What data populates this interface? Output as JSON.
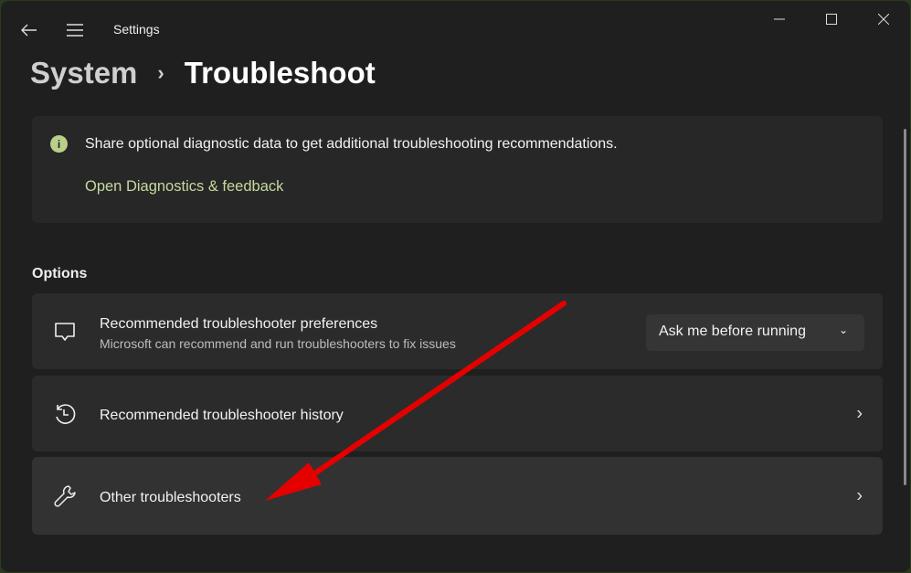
{
  "window": {
    "title": "Settings"
  },
  "breadcrumb": {
    "parent": "System",
    "separator": "›",
    "current": "Troubleshoot"
  },
  "info": {
    "message": "Share optional diagnostic data to get additional troubleshooting recommendations.",
    "link": "Open Diagnostics & feedback",
    "icon": "i"
  },
  "section": {
    "title": "Options"
  },
  "cards": [
    {
      "title": "Recommended troubleshooter preferences",
      "subtitle": "Microsoft can recommend and run troubleshooters to fix issues",
      "dropdown": "Ask me before running"
    },
    {
      "title": "Recommended troubleshooter history"
    },
    {
      "title": "Other troubleshooters"
    }
  ],
  "colors": {
    "accent": "#c7d89e",
    "annotation": "#e50000"
  }
}
